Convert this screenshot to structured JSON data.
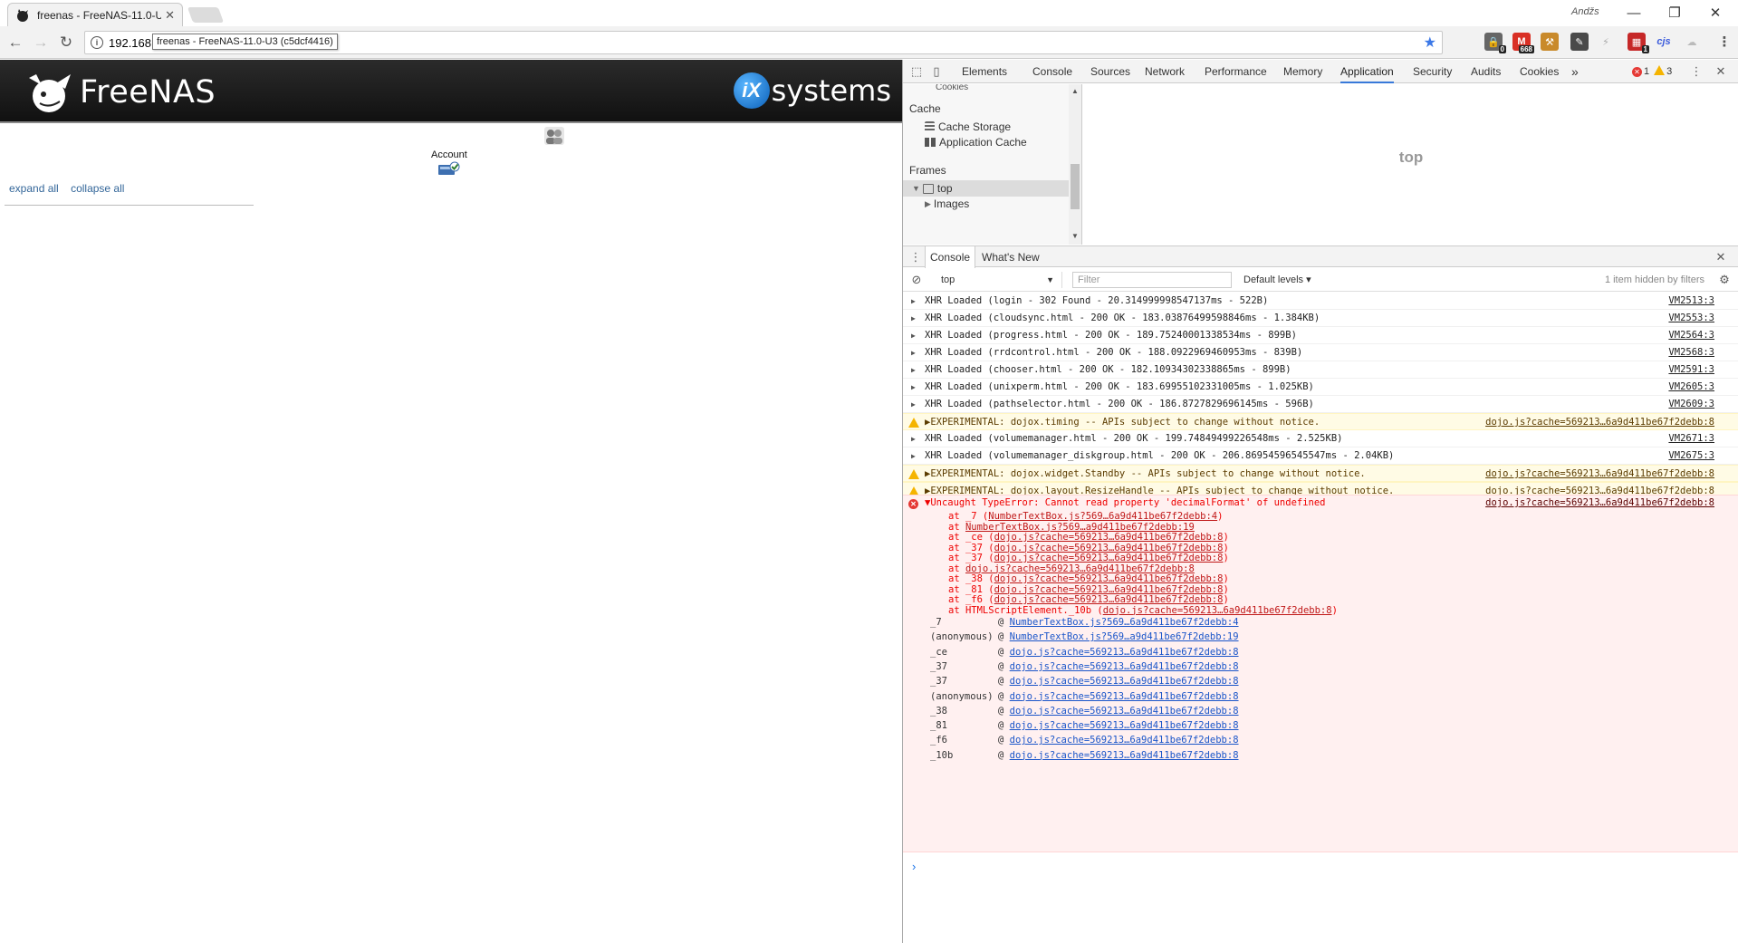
{
  "browser": {
    "tab_title": "freenas - FreeNAS-11.0-U",
    "tab_close": "✕",
    "user_badge": "Andžs",
    "url": "192.168",
    "tooltip": "freenas - FreeNAS-11.0-U3 (c5dcf4416)",
    "extensions": [
      {
        "name": "lock-ext",
        "badge": "0"
      },
      {
        "name": "gmail-ext",
        "badge": "668"
      },
      {
        "name": "tools-ext",
        "badge": ""
      },
      {
        "name": "pen-ext",
        "badge": ""
      },
      {
        "name": "bolt-ext",
        "badge": ""
      },
      {
        "name": "calendar-ext",
        "badge": "1"
      },
      {
        "name": "cjs-ext",
        "label": "cjs"
      },
      {
        "name": "grey-ext",
        "badge": ""
      }
    ]
  },
  "page": {
    "logo_text": "FreeNAS",
    "ix_letters": "iX",
    "ix_text": "systems",
    "account_label": "Account",
    "expand_all": "expand all",
    "collapse_all": "collapse all"
  },
  "devtools": {
    "tabs": [
      "Elements",
      "Console",
      "Sources",
      "Network",
      "Performance",
      "Memory",
      "Application",
      "Security",
      "Audits",
      "Cookies"
    ],
    "active_tab": "Application",
    "more_tabs": "»",
    "error_count": "1",
    "warning_count": "3",
    "sidebar": {
      "cut_item": "Cookies",
      "cache_header": "Cache",
      "cache_storage": "Cache Storage",
      "application_cache": "Application Cache",
      "frames_header": "Frames",
      "frame_top": "top",
      "images": "Images"
    },
    "main_label": "top",
    "drawer": {
      "console_tab": "Console",
      "whats_new_tab": "What's New",
      "context": "top",
      "filter_placeholder": "Filter",
      "levels": "Default levels",
      "hidden_note": "1 item hidden by filters"
    },
    "messages": [
      {
        "type": "log",
        "text": "XHR Loaded (login - 302 Found - 20.314999998547137ms - 522B)",
        "src": "VM2513:3"
      },
      {
        "type": "log",
        "text": "XHR Loaded (cloudsync.html - 200 OK - 183.03876499598846ms - 1.384KB)",
        "src": "VM2553:3"
      },
      {
        "type": "log",
        "text": "XHR Loaded (progress.html - 200 OK - 189.75240001338534ms - 899B)",
        "src": "VM2564:3"
      },
      {
        "type": "log",
        "text": "XHR Loaded (rrdcontrol.html - 200 OK - 188.0922969460953ms - 839B)",
        "src": "VM2568:3"
      },
      {
        "type": "log",
        "text": "XHR Loaded (chooser.html - 200 OK - 182.10934302338865ms - 899B)",
        "src": "VM2591:3"
      },
      {
        "type": "log",
        "text": "XHR Loaded (unixperm.html - 200 OK - 183.69955102331005ms - 1.025KB)",
        "src": "VM2605:3"
      },
      {
        "type": "log",
        "text": "XHR Loaded (pathselector.html - 200 OK - 186.8727829696145ms - 596B)",
        "src": "VM2609:3"
      },
      {
        "type": "warn",
        "text": "▶EXPERIMENTAL: dojox.timing -- APIs subject to change without notice.",
        "src": "dojo.js?cache=569213…6a9d411be67f2debb:8"
      },
      {
        "type": "log",
        "text": "XHR Loaded (volumemanager.html - 200 OK - 199.74849499226548ms - 2.525KB)",
        "src": "VM2671:3"
      },
      {
        "type": "log",
        "text": "XHR Loaded (volumemanager_diskgroup.html - 200 OK - 206.86954596545547ms - 2.04KB)",
        "src": "VM2675:3"
      },
      {
        "type": "warn",
        "text": "▶EXPERIMENTAL: dojox.widget.Standby -- APIs subject to change without notice.",
        "src": "dojo.js?cache=569213…6a9d411be67f2debb:8"
      },
      {
        "type": "warn",
        "text": "▶EXPERIMENTAL: dojox.layout.ResizeHandle -- APIs subject to change without notice.",
        "src": "dojo.js?cache=569213…6a9d411be67f2debb:8"
      }
    ],
    "error": {
      "head": "▼Uncaught TypeError: Cannot read property 'decimalFormat' of undefined",
      "src": "dojo.js?cache=569213…6a9d411be67f2debb:8",
      "stack": [
        {
          "pre": "at _7 (",
          "link": "NumberTextBox.js?569…6a9d411be67f2debb:4",
          "post": ")"
        },
        {
          "pre": "at ",
          "link": "NumberTextBox.js?569…a9d411be67f2debb:19",
          "post": ""
        },
        {
          "pre": "at _ce (",
          "link": "dojo.js?cache=569213…6a9d411be67f2debb:8",
          "post": ")"
        },
        {
          "pre": "at _37 (",
          "link": "dojo.js?cache=569213…6a9d411be67f2debb:8",
          "post": ")"
        },
        {
          "pre": "at _37 (",
          "link": "dojo.js?cache=569213…6a9d411be67f2debb:8",
          "post": ")"
        },
        {
          "pre": "at ",
          "link": "dojo.js?cache=569213…6a9d411be67f2debb:8",
          "post": ""
        },
        {
          "pre": "at _38 (",
          "link": "dojo.js?cache=569213…6a9d411be67f2debb:8",
          "post": ")"
        },
        {
          "pre": "at _81 (",
          "link": "dojo.js?cache=569213…6a9d411be67f2debb:8",
          "post": ")"
        },
        {
          "pre": "at _f6 (",
          "link": "dojo.js?cache=569213…6a9d411be67f2debb:8",
          "post": ")"
        },
        {
          "pre": "at HTMLScriptElement._10b (",
          "link": "dojo.js?cache=569213…6a9d411be67f2debb:8",
          "post": ")"
        }
      ],
      "table": [
        {
          "fn": "_7",
          "link": "NumberTextBox.js?569…6a9d411be67f2debb:4"
        },
        {
          "fn": "(anonymous)",
          "link": "NumberTextBox.js?569…a9d411be67f2debb:19"
        },
        {
          "fn": "_ce",
          "link": "dojo.js?cache=569213…6a9d411be67f2debb:8"
        },
        {
          "fn": "_37",
          "link": "dojo.js?cache=569213…6a9d411be67f2debb:8"
        },
        {
          "fn": "_37",
          "link": "dojo.js?cache=569213…6a9d411be67f2debb:8"
        },
        {
          "fn": "(anonymous)",
          "link": "dojo.js?cache=569213…6a9d411be67f2debb:8"
        },
        {
          "fn": "_38",
          "link": "dojo.js?cache=569213…6a9d411be67f2debb:8"
        },
        {
          "fn": "_81",
          "link": "dojo.js?cache=569213…6a9d411be67f2debb:8"
        },
        {
          "fn": "_f6",
          "link": "dojo.js?cache=569213…6a9d411be67f2debb:8"
        },
        {
          "fn": "_10b",
          "link": "dojo.js?cache=569213…6a9d411be67f2debb:8"
        }
      ]
    },
    "prompt": "›"
  },
  "colors": {
    "accent_blue": "#3879d9",
    "error_red": "#e53935",
    "warning_yellow": "#f5b400",
    "link_blue": "#1a55c9"
  }
}
